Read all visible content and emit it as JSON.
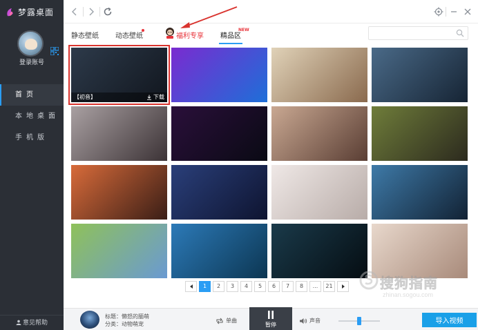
{
  "app": {
    "name": "梦露桌面",
    "accent": "#2a9df4",
    "sidebar_bg": "#2b2f36"
  },
  "sidebar": {
    "login_label": "登录账号",
    "items": [
      {
        "label": "首页",
        "active": true
      },
      {
        "label": "本地桌面",
        "active": false
      },
      {
        "label": "手机版",
        "active": false
      }
    ],
    "help_label": "意见帮助"
  },
  "toolbar": {
    "back_icon": "chevron-left-icon",
    "forward_icon": "chevron-right-icon",
    "refresh_icon": "refresh-icon",
    "settings_icon": "gear-icon",
    "min_icon": "minimize-icon",
    "close_icon": "close-icon"
  },
  "tabs": [
    {
      "label": "静态壁纸",
      "active": false
    },
    {
      "label": "动态壁纸",
      "active": false,
      "dot": true
    },
    {
      "label": "福利专享",
      "active": false
    },
    {
      "label": "精品区",
      "active": true,
      "badge": "NEW"
    }
  ],
  "search": {
    "placeholder": ""
  },
  "wallpapers": [
    {
      "tag": "【初音】",
      "action": "下载",
      "selected": true,
      "colors": [
        "#2d3a4a",
        "#11161e"
      ]
    },
    {
      "colors": [
        "#7a2bd0",
        "#1e6fd8"
      ]
    },
    {
      "colors": [
        "#e0d2b8",
        "#8a6a4e"
      ]
    },
    {
      "colors": [
        "#4a6a88",
        "#162434"
      ]
    },
    {
      "colors": [
        "#a9a0a2",
        "#3c3336"
      ]
    },
    {
      "colors": [
        "#2a0f3a",
        "#0a0a14"
      ]
    },
    {
      "colors": [
        "#c9a892",
        "#5a3e34"
      ]
    },
    {
      "colors": [
        "#6f7d3a",
        "#2c2a1e"
      ]
    },
    {
      "colors": [
        "#d86b3a",
        "#3a1e16"
      ]
    },
    {
      "colors": [
        "#2a3f7a",
        "#0e1430"
      ]
    },
    {
      "colors": [
        "#efe8e6",
        "#b8aca8"
      ]
    },
    {
      "colors": [
        "#3e7aa8",
        "#122234"
      ]
    },
    {
      "colors": [
        "#8fc15a",
        "#6a9ad2"
      ]
    },
    {
      "colors": [
        "#2c7ab8",
        "#0c3652"
      ]
    },
    {
      "colors": [
        "#1a3a4a",
        "#050d12"
      ]
    },
    {
      "colors": [
        "#e8d8cc",
        "#a88a7a"
      ]
    }
  ],
  "pager": {
    "pages": [
      "1",
      "2",
      "3",
      "4",
      "5",
      "6",
      "7",
      "8",
      "...",
      "21"
    ],
    "current": "1"
  },
  "watermark": {
    "main": "搜狗指南",
    "sub": "zhinan.sogou.com"
  },
  "player": {
    "title_label": "标题：懒怒的腼萌",
    "category_label": "分类：动物萌宠",
    "loop_label": "单曲",
    "pause_label": "暂停",
    "sound_label": "声音",
    "volume": 0.5,
    "import_label": "导入视频"
  }
}
